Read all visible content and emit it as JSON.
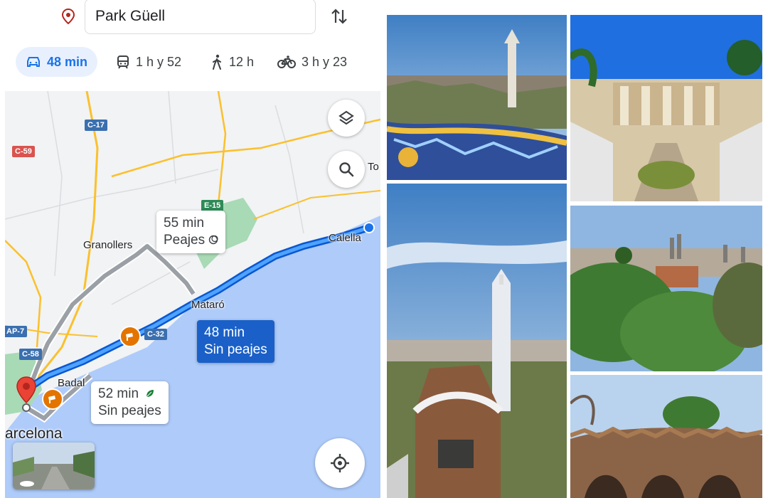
{
  "directions": {
    "destination": "Park Güell",
    "modes": [
      {
        "icon": "car-icon",
        "label": "48 min",
        "active": true
      },
      {
        "icon": "transit-icon",
        "label": "1 h y 52",
        "active": false
      },
      {
        "icon": "walk-icon",
        "label": "12 h",
        "active": false
      },
      {
        "icon": "bike-icon",
        "label": "3 h y 23",
        "active": false
      }
    ]
  },
  "map": {
    "places": {
      "granollers": "Granollers",
      "mataro": "Mataró",
      "calella": "Calella",
      "badalona": "Badal",
      "barcelona": "arcelona",
      "to": "To"
    },
    "roads": {
      "c17": "C-17",
      "c59": "C-59",
      "e15": "E-15",
      "c32": "C-32",
      "ap7": "AP-7",
      "c58": "C-58"
    },
    "routes": [
      {
        "duration": "55 min",
        "note": "Peajes",
        "selected": false
      },
      {
        "duration": "48 min",
        "note": "Sin peajes",
        "selected": true
      },
      {
        "duration": "52 min",
        "note": "Sin peajes",
        "selected": false
      }
    ],
    "colors": {
      "route_selected": "#1a73e8",
      "route_alt": "#9aa0a6",
      "sea": "#aecbfa",
      "land": "#f1f3f4",
      "park": "#a8dab5",
      "highway": "#fbc02d",
      "destination_pin": "#ea4335",
      "toll_warning": "#e37400"
    }
  },
  "photos": [
    {
      "subject": "mosaic-bench-terrace"
    },
    {
      "subject": "dragon-stairway-hypostyle"
    },
    {
      "subject": "gatehouse-tower"
    },
    {
      "subject": "city-view-pines"
    },
    {
      "subject": "stone-viaduct"
    }
  ]
}
